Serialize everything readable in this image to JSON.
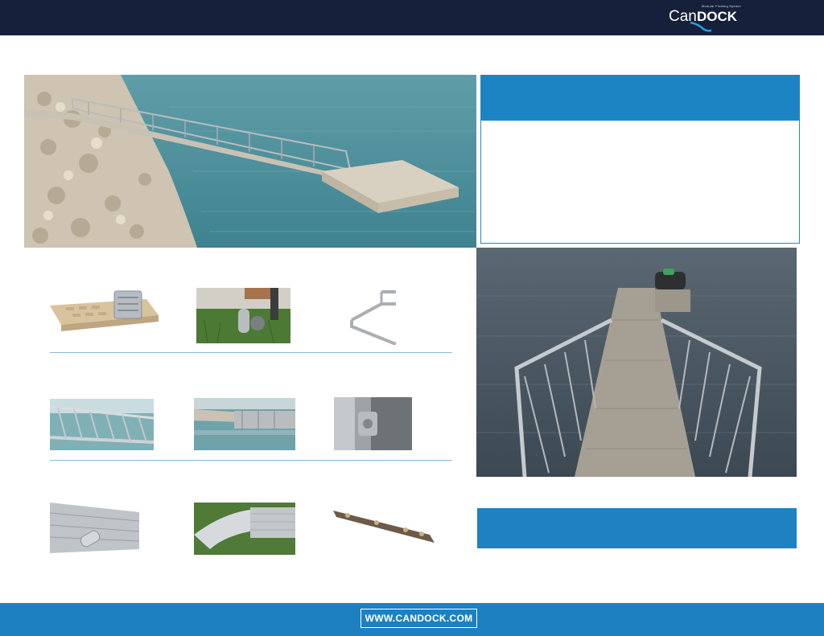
{
  "header": {
    "logo": {
      "tagline": "Modular Floating System",
      "brand_part1": "Can",
      "brand_part2": "DOCK"
    }
  },
  "footer": {
    "url": "WWW.CANDOCK.COM"
  },
  "colors": {
    "navy": "#17203a",
    "brand_blue": "#1d84c4",
    "divider": "#8eb9d9"
  },
  "thumbnails": [
    {
      "row": 1,
      "items": [
        "dock-surface-panel",
        "gangway-wheel-roller",
        "aluminum-frame-corner"
      ]
    },
    {
      "row": 2,
      "items": [
        "gangway-railing",
        "gangway-dock-connection",
        "hinge-bracket"
      ]
    },
    {
      "row": 3,
      "items": [
        "roller-mount",
        "transition-plate",
        "connector-bracket"
      ]
    }
  ]
}
